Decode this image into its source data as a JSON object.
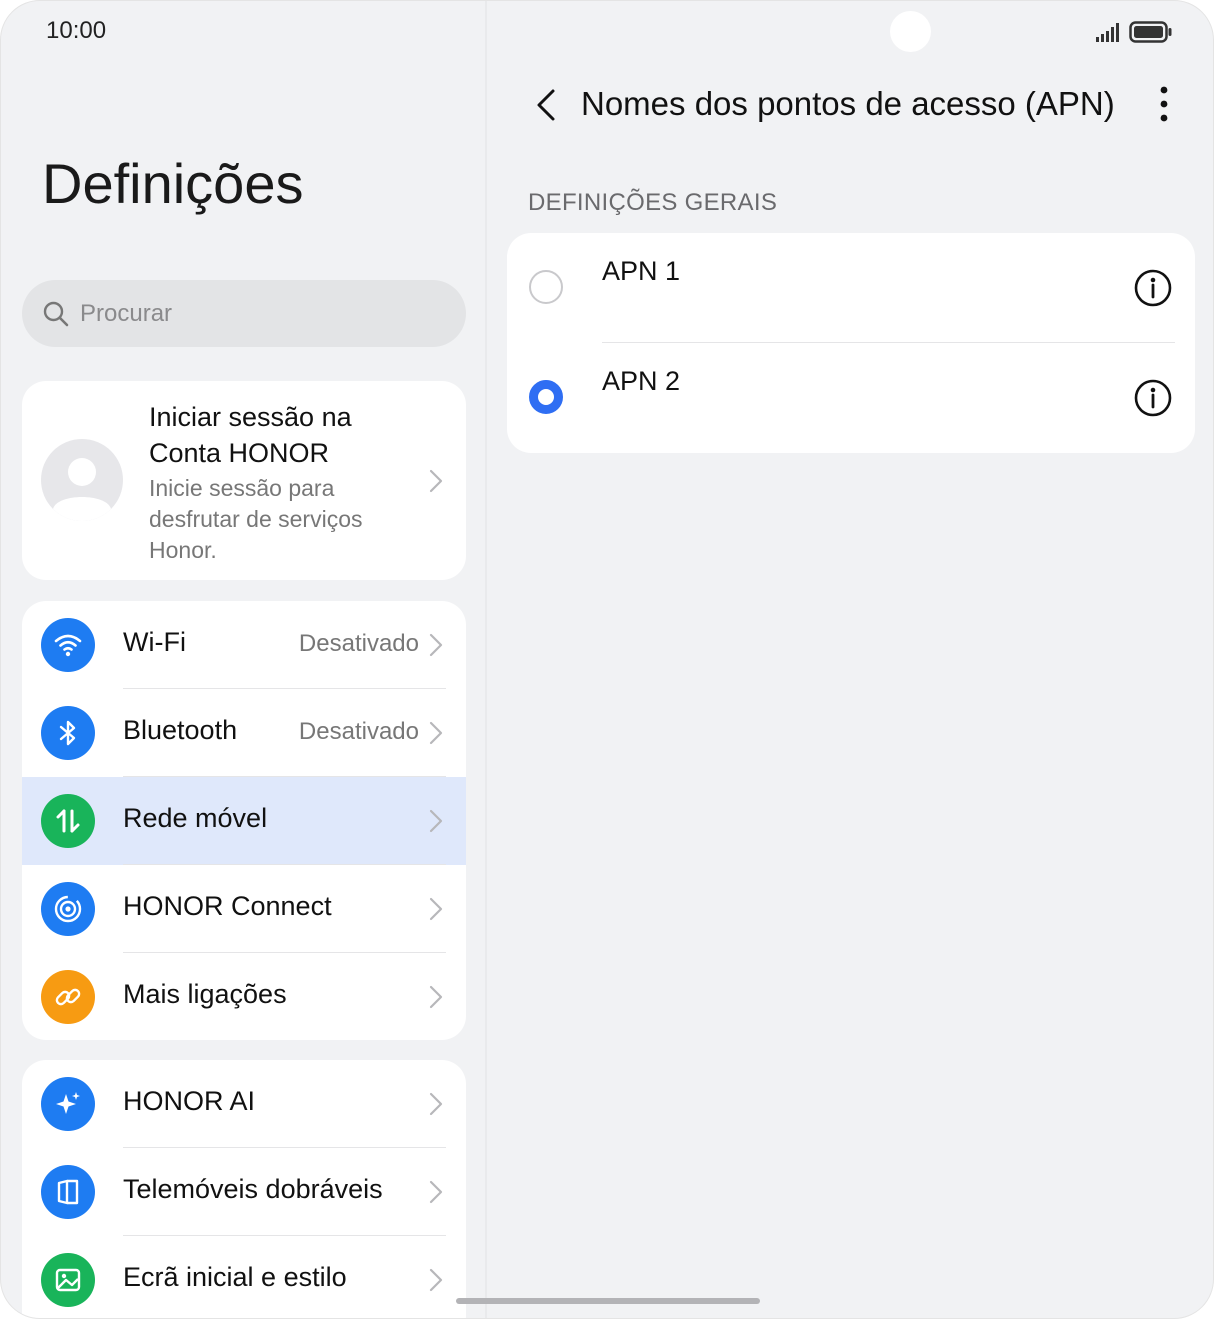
{
  "status_bar": {
    "time": "10:00"
  },
  "left": {
    "title": "Definições",
    "search": {
      "placeholder": "Procurar"
    },
    "account": {
      "title": "Iniciar sessão na Conta HONOR",
      "subtitle": "Inicie sessão para desfrutar de serviços Honor."
    },
    "group1": [
      {
        "label": "Wi-Fi",
        "value": "Desativado",
        "icon": "wifi-icon",
        "color": "#1e7cf2"
      },
      {
        "label": "Bluetooth",
        "value": "Desativado",
        "icon": "bluetooth-icon",
        "color": "#1e7cf2"
      },
      {
        "label": "Rede móvel",
        "value": "",
        "icon": "mobile-data-icon",
        "color": "#19b45a",
        "selected": true
      },
      {
        "label": "HONOR Connect",
        "value": "",
        "icon": "honor-connect-icon",
        "color": "#1e7cf2"
      },
      {
        "label": "Mais ligações",
        "value": "",
        "icon": "link-icon",
        "color": "#f79b12"
      }
    ],
    "group2": [
      {
        "label": "HONOR AI",
        "icon": "honor-ai-icon",
        "color": "#1e7cf2"
      },
      {
        "label": "Telemóveis dobráveis",
        "icon": "foldable-icon",
        "color": "#1e7cf2"
      },
      {
        "label": "Ecrã inicial e estilo",
        "icon": "image-icon",
        "color": "#19b45a"
      }
    ]
  },
  "right": {
    "title": "Nomes dos pontos de acesso (APN)",
    "section": "DEFINIÇÕES GERAIS",
    "apns": [
      {
        "name": "APN 1",
        "selected": false
      },
      {
        "name": "APN 2",
        "selected": true
      }
    ]
  },
  "colors": {
    "accent": "#2f6ef3",
    "background": "#f1f2f4",
    "selected_row": "#dfe8fb"
  }
}
